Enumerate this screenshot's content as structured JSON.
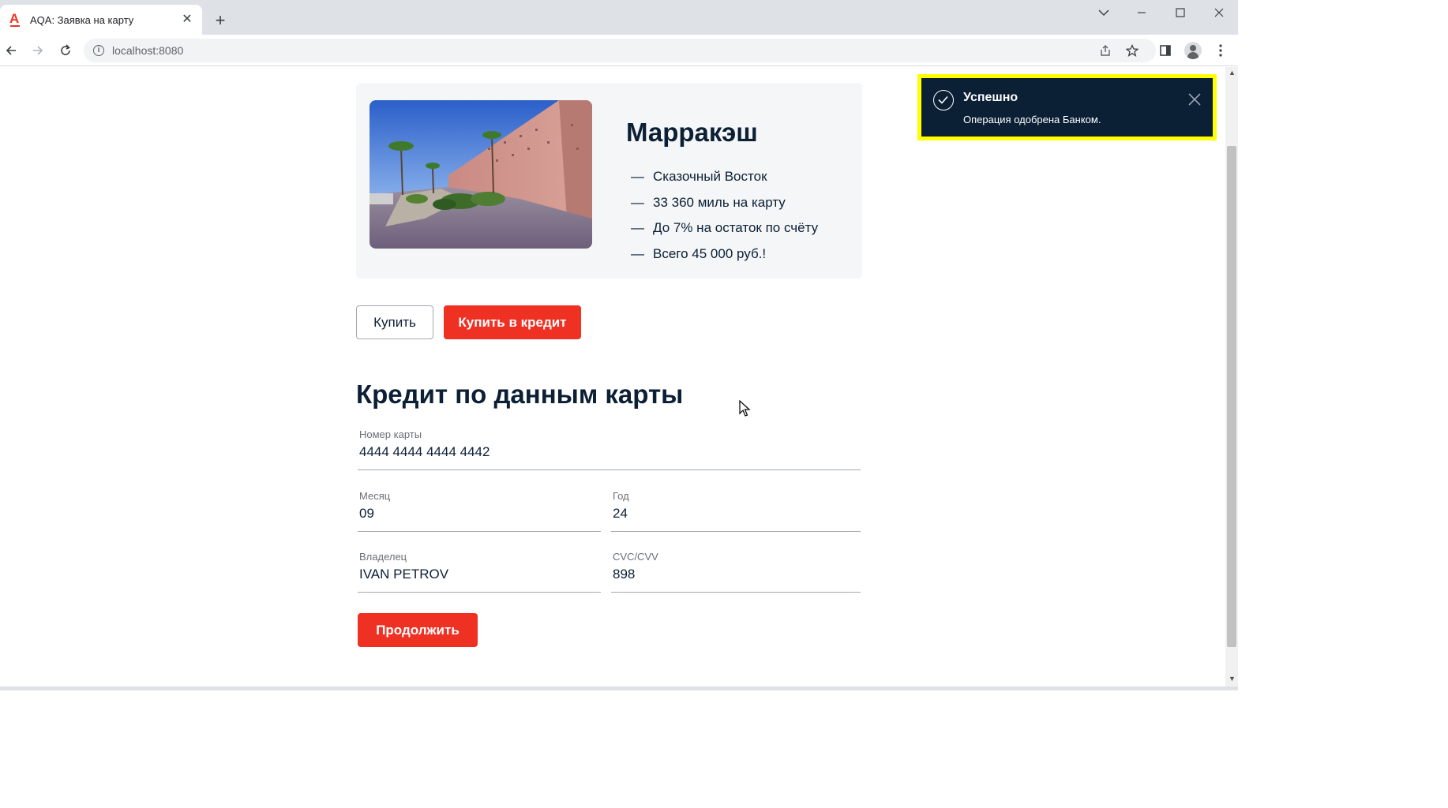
{
  "browser": {
    "tab_title": "AQA: Заявка на карту",
    "url": "localhost:8080",
    "tab_close": "✕",
    "new_tab": "+",
    "info": "i"
  },
  "product": {
    "title": "Марракэш",
    "features": [
      "Сказочный Восток",
      "33 360 миль на карту",
      "До 7% на остаток по счёту",
      "Всего 45 000 руб.!"
    ],
    "buy_label": "Купить",
    "buy_credit_label": "Купить в кредит"
  },
  "form": {
    "title": "Кредит по данным карты",
    "card_number": {
      "label": "Номер карты",
      "value": "4444 4444 4444 4442"
    },
    "month": {
      "label": "Месяц",
      "value": "09"
    },
    "year": {
      "label": "Год",
      "value": "24"
    },
    "owner": {
      "label": "Владелец",
      "value": "IVAN PETROV"
    },
    "cvc": {
      "label": "CVC/CVV",
      "value": "898"
    },
    "continue_label": "Продолжить"
  },
  "notification": {
    "title": "Успешно",
    "text": "Операция одобрена Банком."
  },
  "colors": {
    "accent": "#ef3124",
    "text": "#0b1f35",
    "toast_bg": "#0b1f35",
    "toast_border": "#ffff00",
    "card_bg": "#f5f6f7"
  }
}
